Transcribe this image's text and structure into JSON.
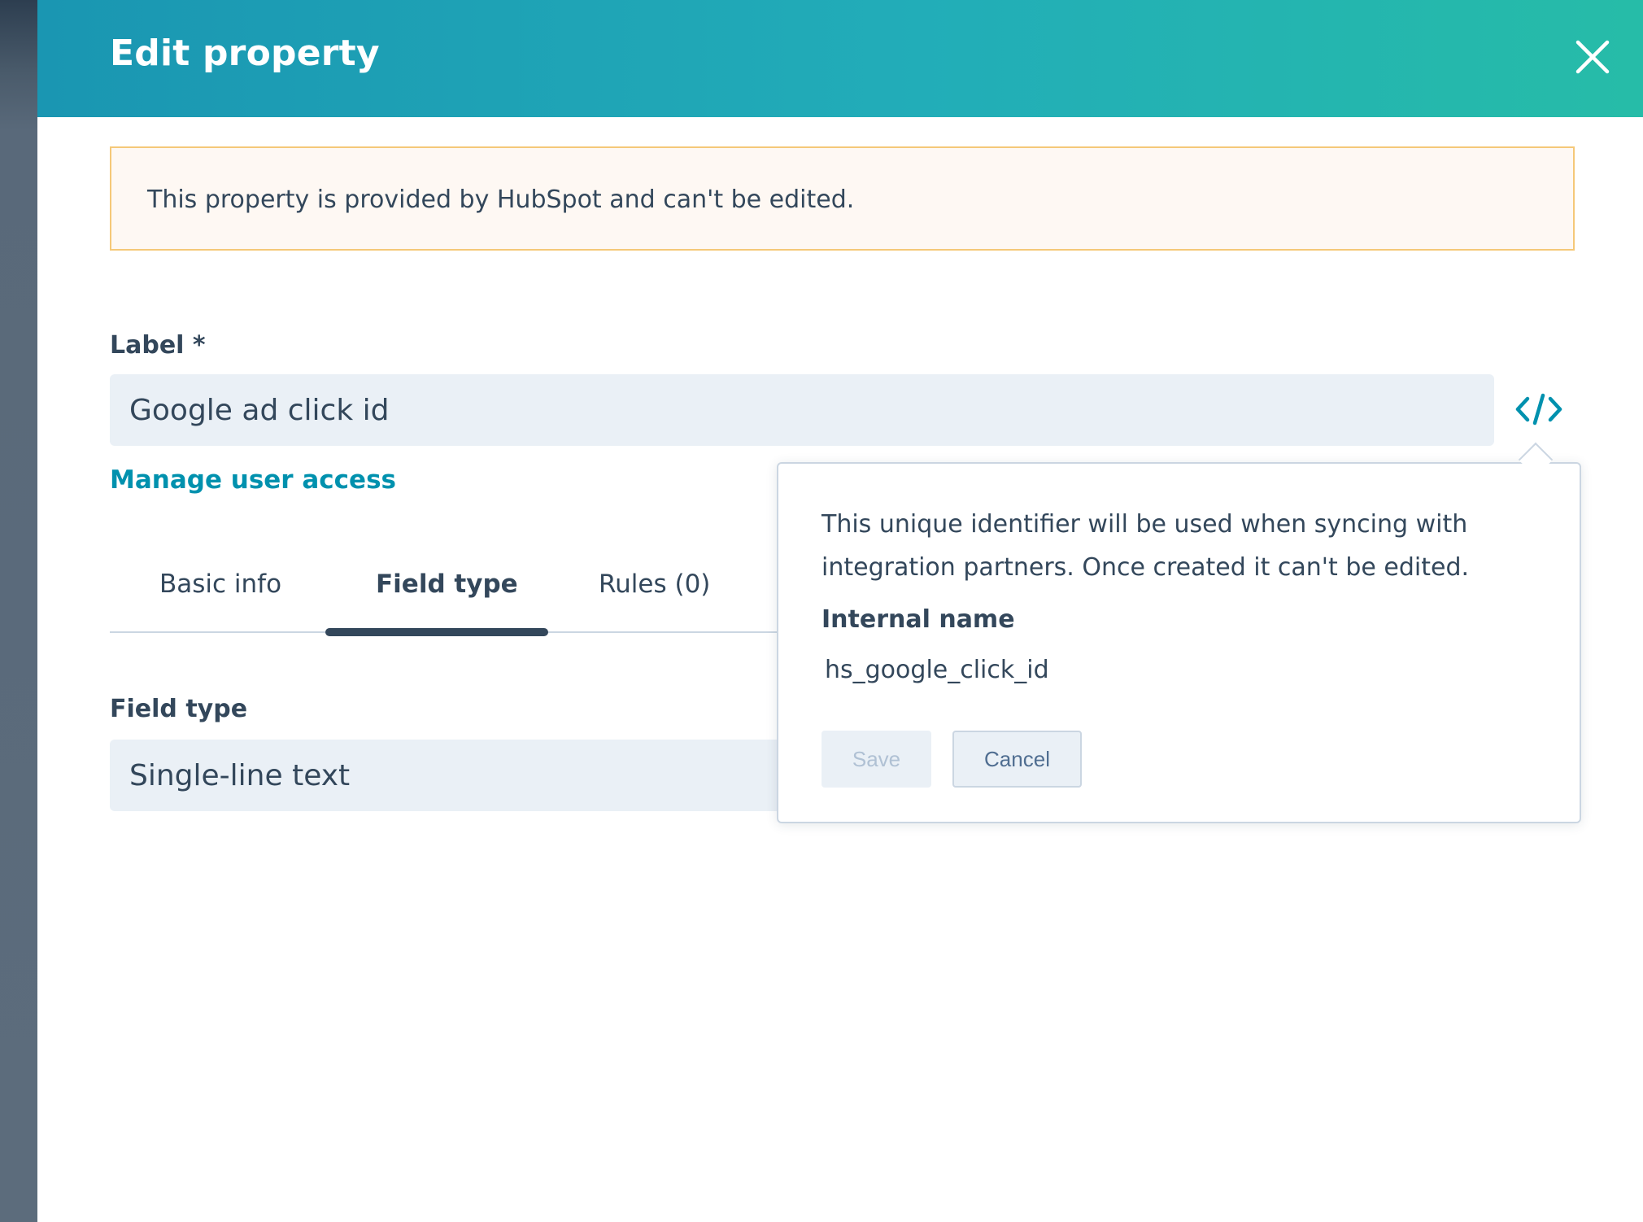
{
  "header": {
    "title": "Edit property"
  },
  "alert": {
    "text": "This property is provided by HubSpot and can't be edited."
  },
  "label_field": {
    "label": "Label *",
    "value": "Google ad click id"
  },
  "manage_access_link": "Manage user access",
  "tabs": [
    {
      "label": "Basic info",
      "active": false
    },
    {
      "label": "Field type",
      "active": true
    },
    {
      "label": "Rules (0)",
      "active": false
    }
  ],
  "field_type": {
    "label": "Field type",
    "value": "Single-line text"
  },
  "popover": {
    "description": "This unique identifier will be used when syncing with integration partners. Once created it can't be edited.",
    "heading": "Internal name",
    "value": "hs_google_click_id",
    "save_label": "Save",
    "cancel_label": "Cancel"
  },
  "icons": {
    "close": "close-icon",
    "code": "code-icon"
  },
  "colors": {
    "header_start": "#1a96b2",
    "header_end": "#26bca8",
    "link": "#0091ae",
    "alert_bg": "#fef8f3",
    "alert_border": "#f5c878",
    "text": "#33475b"
  }
}
